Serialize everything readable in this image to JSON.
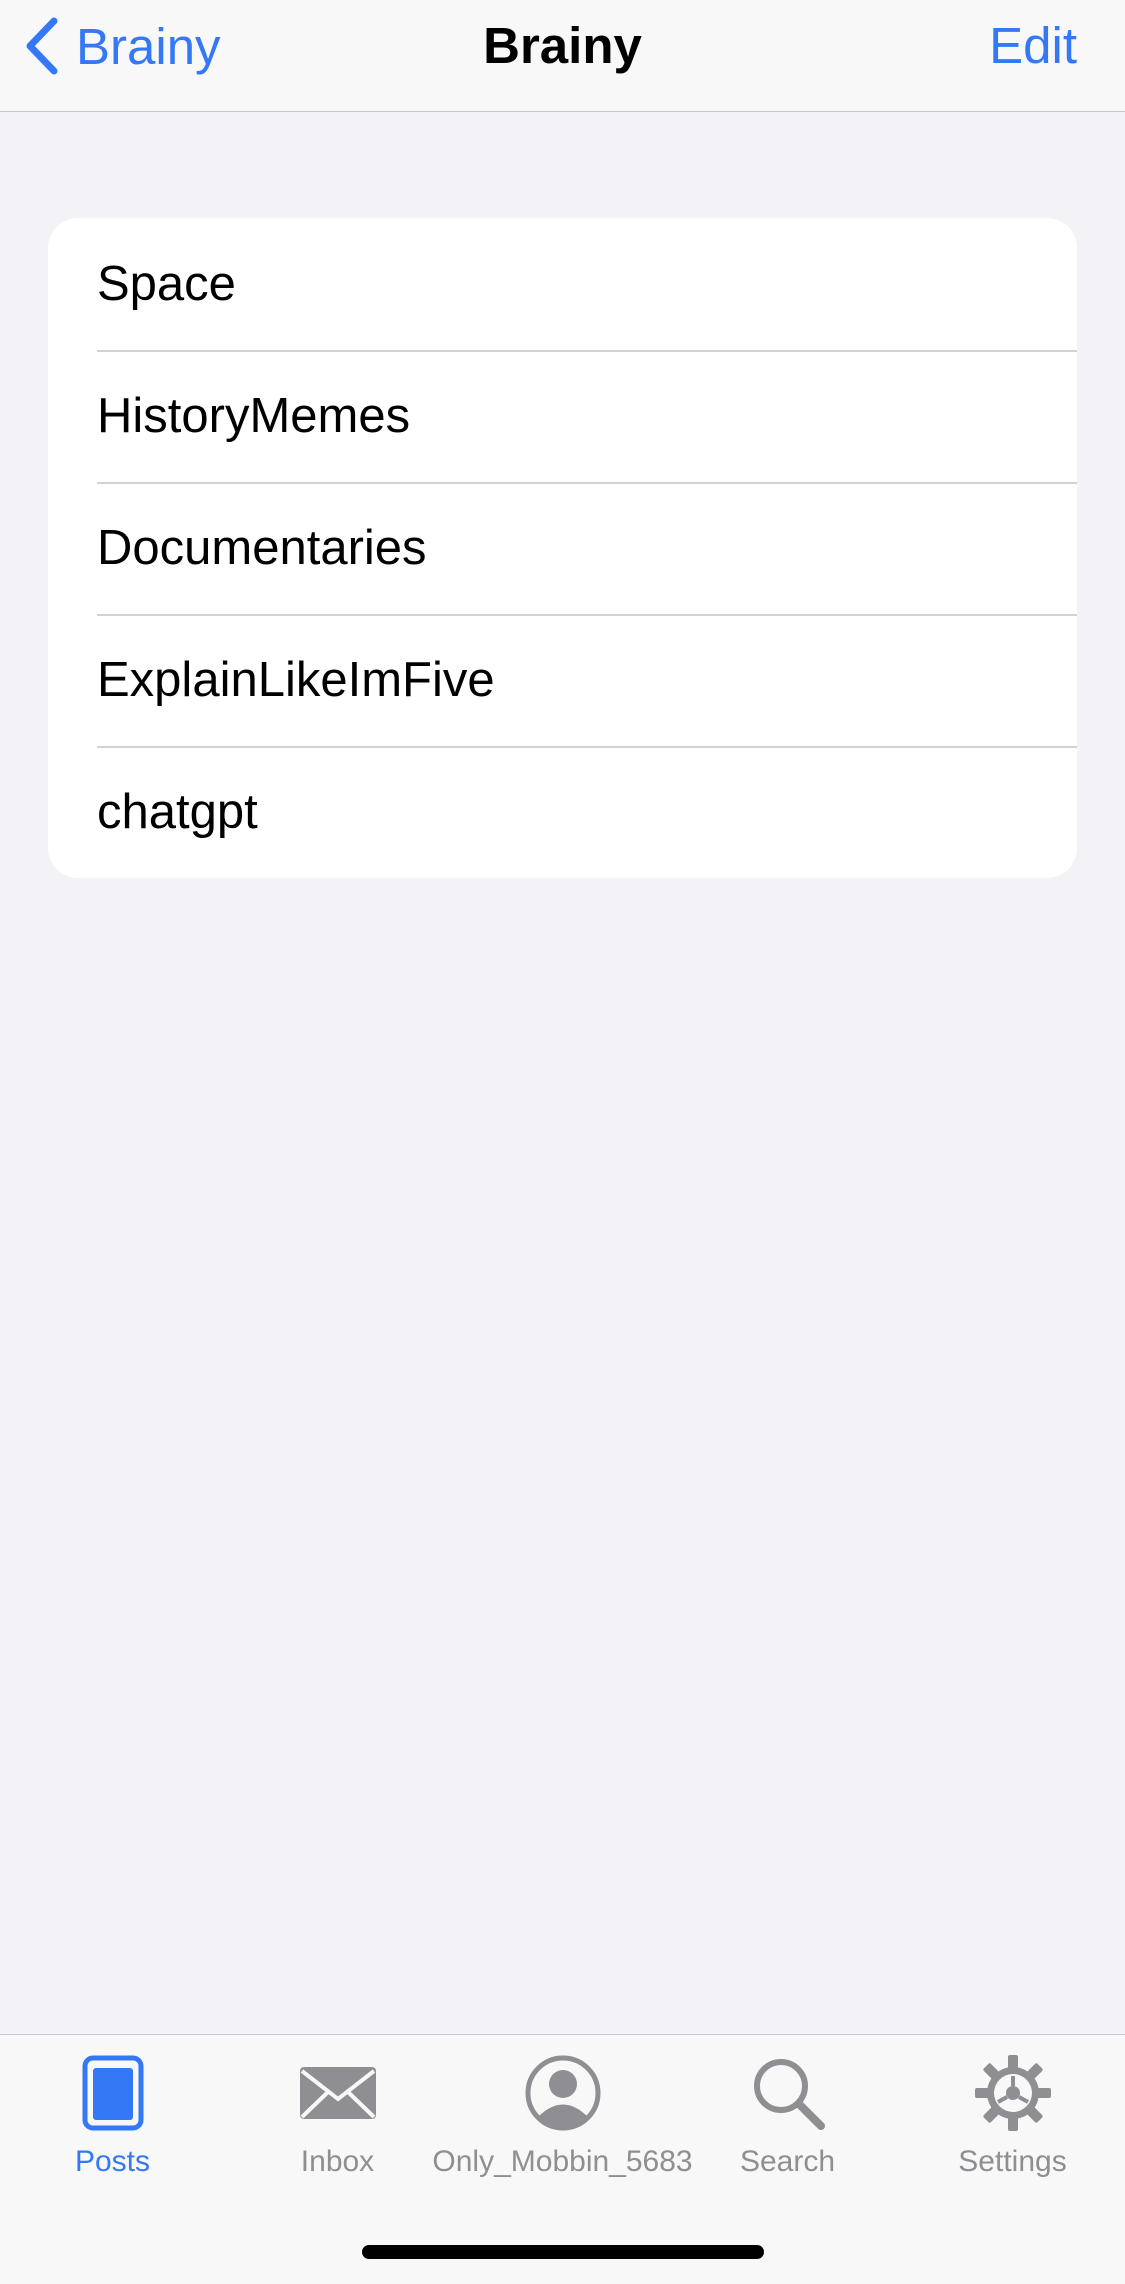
{
  "navbar": {
    "back_label": "Brainy",
    "title": "Brainy",
    "edit_label": "Edit"
  },
  "list": {
    "items": [
      {
        "label": "Space"
      },
      {
        "label": "HistoryMemes"
      },
      {
        "label": "Documentaries"
      },
      {
        "label": "ExplainLikeImFive"
      },
      {
        "label": "chatgpt"
      }
    ]
  },
  "tabbar": {
    "tabs": [
      {
        "label": "Posts",
        "icon": "posts-icon",
        "active": true
      },
      {
        "label": "Inbox",
        "icon": "envelope-icon",
        "active": false
      },
      {
        "label": "Only_Mobbin_5683",
        "icon": "profile-icon",
        "active": false
      },
      {
        "label": "Search",
        "icon": "search-icon",
        "active": false
      },
      {
        "label": "Settings",
        "icon": "gear-icon",
        "active": false
      }
    ]
  },
  "colors": {
    "accent": "#3478f6",
    "inactive": "#8e8e93",
    "background": "#f2f2f7"
  }
}
